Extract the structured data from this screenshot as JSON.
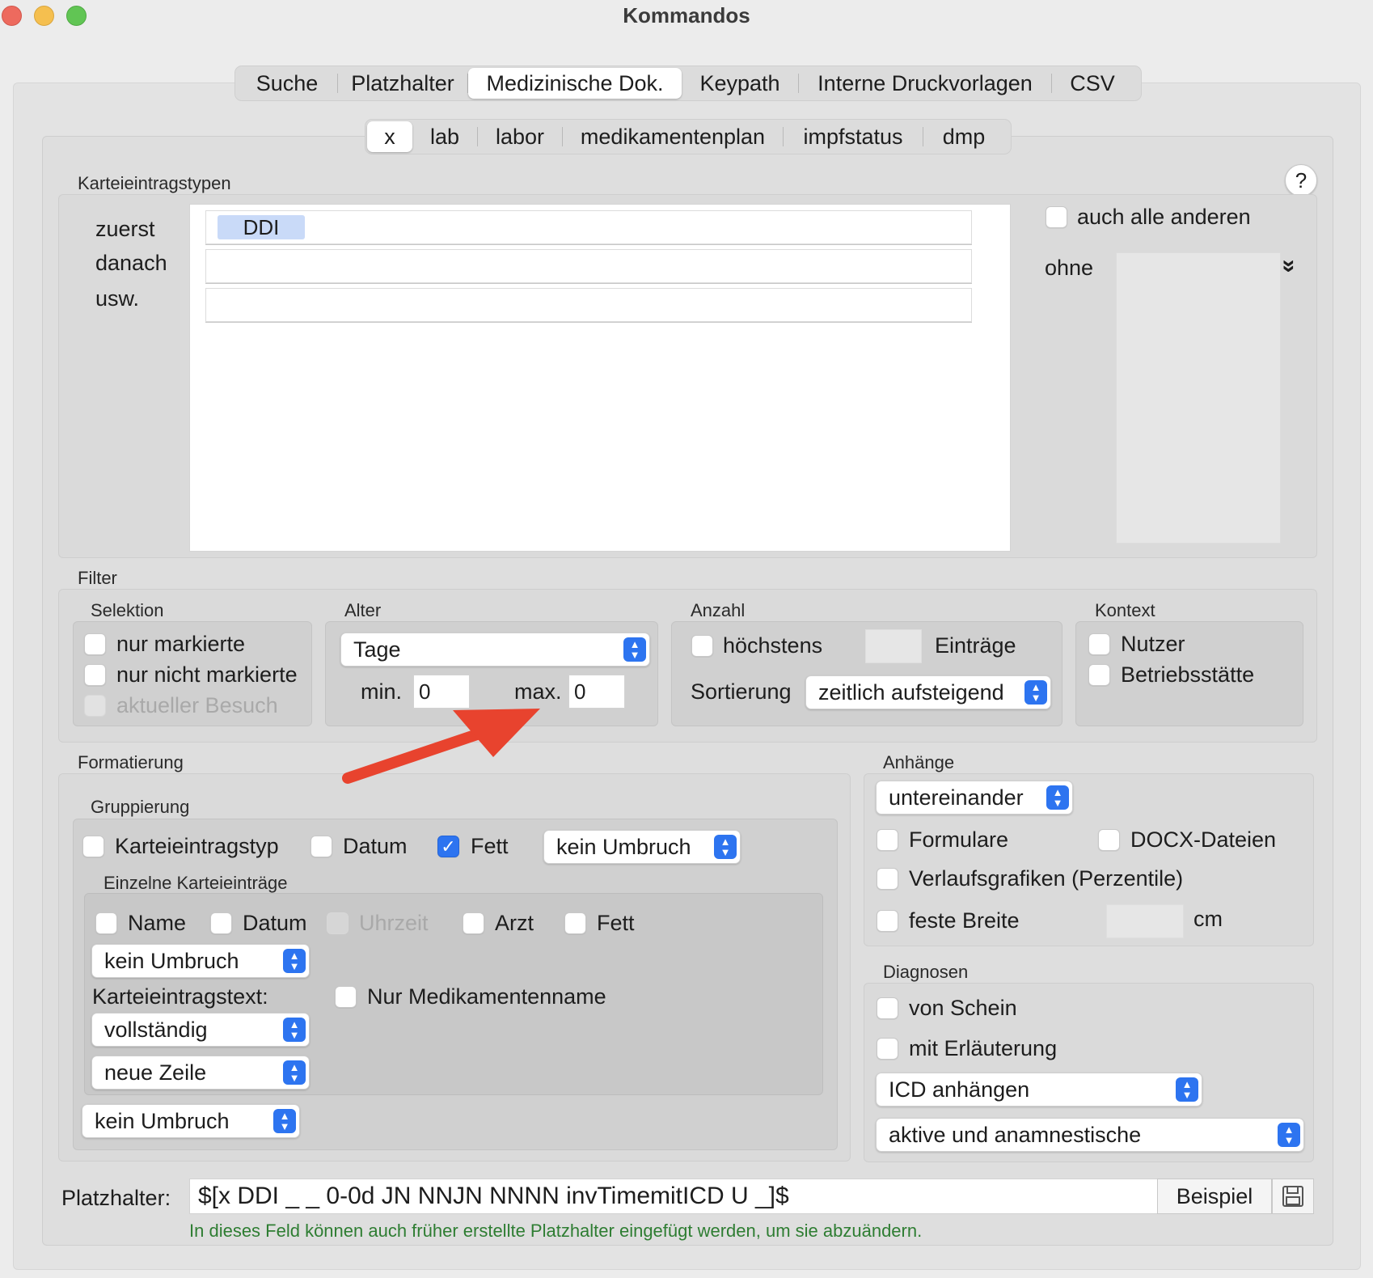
{
  "window": {
    "title": "Kommandos"
  },
  "tabs": [
    "Suche",
    "Platzhalter",
    "Medizinische Dok.",
    "Keypath",
    "Interne Druckvorlagen",
    "CSV"
  ],
  "subtabs": [
    "x",
    "lab",
    "labor",
    "medikamentenplan",
    "impfstatus",
    "dmp"
  ],
  "karteieintragstypen": {
    "title": "Karteieintragstypen",
    "help": "?",
    "row_labels": [
      "zuerst",
      "danach",
      "usw."
    ],
    "rows": [
      "DDI",
      "",
      ""
    ],
    "auch_alle_anderen": "auch alle anderen",
    "ohne": "ohne",
    "chevron": "»"
  },
  "filter": {
    "title": "Filter",
    "selektion": {
      "title": "Selektion",
      "nur_markierte": "nur markierte",
      "nur_nicht_markierte": "nur nicht markierte",
      "aktueller_besuch": "aktueller Besuch"
    },
    "alter": {
      "title": "Alter",
      "unit": "Tage",
      "min_label": "min.",
      "min_value": "0",
      "max_label": "max.",
      "max_value": "0"
    },
    "anzahl": {
      "title": "Anzahl",
      "hoechstens": "höchstens",
      "eintraege": "Einträge",
      "sortierung_label": "Sortierung",
      "sortierung": "zeitlich aufsteigend"
    },
    "kontext": {
      "title": "Kontext",
      "nutzer": "Nutzer",
      "betriebsstaette": "Betriebsstätte"
    }
  },
  "formatierung": {
    "title": "Formatierung",
    "gruppierung": {
      "title": "Gruppierung",
      "karteieintragstyp": "Karteieintragstyp",
      "datum": "Datum",
      "fett": "Fett",
      "umbruch": "kein Umbruch"
    },
    "einzelne": {
      "title": "Einzelne Karteieinträge",
      "name": "Name",
      "datum": "Datum",
      "uhrzeit": "Uhrzeit",
      "arzt": "Arzt",
      "fett": "Fett",
      "umbruch": "kein Umbruch",
      "text_label": "Karteieintragstext:",
      "nur_medikamentenname": "Nur Medikamentenname",
      "text_mode": "vollständig",
      "zeile": "neue Zeile"
    },
    "outer_umbruch": "kein Umbruch"
  },
  "anhaenge": {
    "title": "Anhänge",
    "anordnung": "untereinander",
    "formulare": "Formulare",
    "docx": "DOCX-Dateien",
    "verlaufsgrafiken": "Verlaufsgrafiken (Perzentile)",
    "feste_breite": "feste Breite",
    "unit": "cm"
  },
  "diagnosen": {
    "title": "Diagnosen",
    "von_schein": "von Schein",
    "mit_erlaeuterung": "mit Erläuterung",
    "icd": "ICD anhängen",
    "art": "aktive und anamnestische"
  },
  "platzhalter": {
    "label": "Platzhalter:",
    "value": "$[x DDI _ _ 0-0d JN NNJN NNNN invTimemitICD U _]$",
    "beispiel": "Beispiel",
    "hint": "In dieses Feld können auch früher erstellte Platzhalter eingefügt werden, um sie abzuändern."
  },
  "colors": {
    "accent": "#2d74f0",
    "arrow": "#e8432e",
    "hint": "#2e7d32",
    "chip": "#c9daf8"
  }
}
